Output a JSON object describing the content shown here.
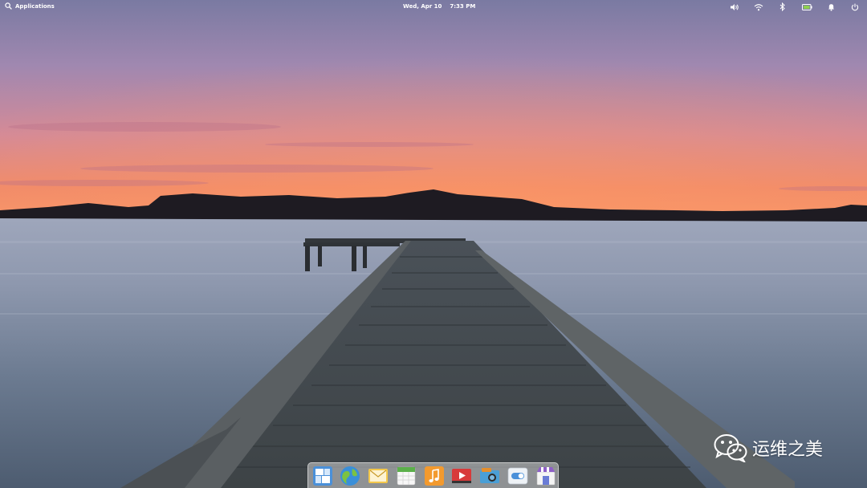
{
  "panel": {
    "applications_label": "Applications",
    "date": "Wed, Apr 10",
    "time": "7:33 PM",
    "indicators": [
      "volume-icon",
      "wifi-icon",
      "bluetooth-icon",
      "battery-icon",
      "notifications-icon",
      "power-icon"
    ]
  },
  "watermark": {
    "text": "运维之美"
  },
  "dock": {
    "items": [
      "multitasking-view",
      "web-browser",
      "mail",
      "calendar",
      "music",
      "videos",
      "photos",
      "system-settings",
      "app-center"
    ]
  },
  "colors": {
    "panel_text": "#ffffff",
    "battery": "#8fd14f"
  }
}
